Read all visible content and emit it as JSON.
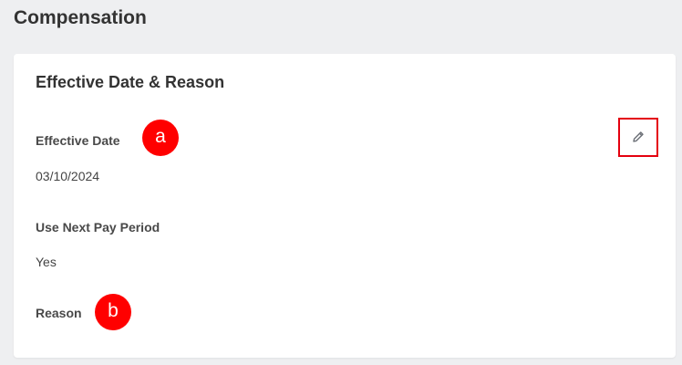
{
  "page": {
    "title": "Compensation"
  },
  "card": {
    "title": "Effective Date & Reason",
    "fields": [
      {
        "label": "Effective Date",
        "value": "03/10/2024",
        "marker": "a"
      },
      {
        "label": "Use Next Pay Period",
        "value": "Yes"
      },
      {
        "label": "Reason",
        "value": "",
        "marker": "b"
      }
    ],
    "edit_icon": "pencil-icon"
  },
  "colors": {
    "background": "#eeeff1",
    "card": "#ffffff",
    "marker": "#ff0000",
    "highlight": "#e4000f",
    "text": "#333333"
  }
}
